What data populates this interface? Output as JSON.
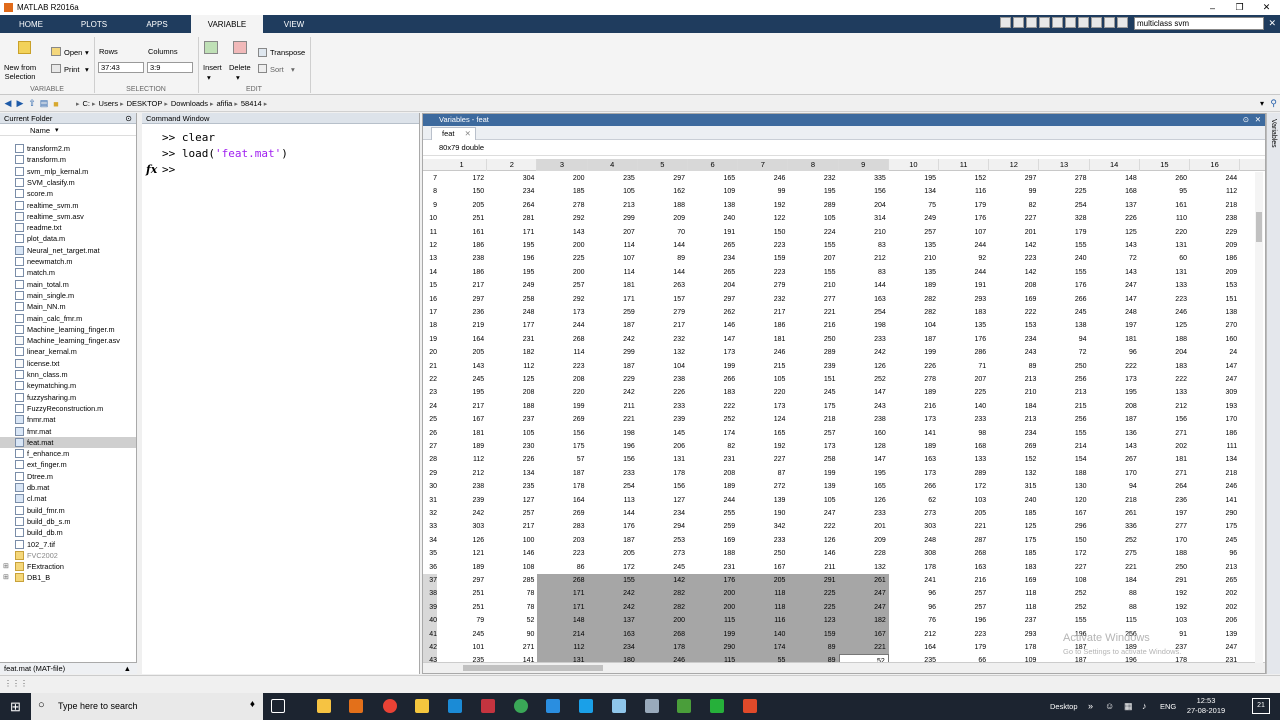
{
  "window": {
    "title": "MATLAB R2016a"
  },
  "tabs": [
    {
      "label": "HOME"
    },
    {
      "label": "PLOTS"
    },
    {
      "label": "APPS"
    },
    {
      "label": "VARIABLE"
    },
    {
      "label": "VIEW"
    }
  ],
  "search": {
    "value": "multiclass svm"
  },
  "ribbon": {
    "new_from_selection": "New from\nSelection",
    "open": "Open",
    "print": "Print",
    "rows_label": "Rows",
    "rows_value": "37:43",
    "columns_label": "Columns",
    "columns_value": "3:9",
    "insert": "Insert",
    "delete": "Delete",
    "transpose": "Transpose",
    "sort": "Sort",
    "group_variable": "VARIABLE",
    "group_selection": "SELECTION",
    "group_edit": "EDIT"
  },
  "path": [
    "C:",
    "Users",
    "DESKTOP",
    "Downloads",
    "afifia",
    "58414"
  ],
  "current_folder": {
    "title": "Current Folder",
    "name_col": "Name",
    "files": [
      "transform2.m",
      "transform.m",
      "svm_mlp_kernal.m",
      "SVM_clasify.m",
      "score.m",
      "realtime_svm.m",
      "realtime_svm.asv",
      "readme.txt",
      "plot_data.m",
      "Neural_net_target.mat",
      "neewmatch.m",
      "match.m",
      "main_total.m",
      "main_single.m",
      "Main_NN.m",
      "main_calc_fmr.m",
      "Machine_learning_finger.m",
      "Machine_learning_finger.asv",
      "linear_kernal.m",
      "license.txt",
      "knn_class.m",
      "keymatching.m",
      "fuzzysharing.m",
      "FuzzyReconstruction.m",
      "fnmr.mat",
      "fmr.mat",
      "feat.mat",
      "f_enhance.m",
      "ext_finger.m",
      "Dtree.m",
      "db.mat",
      "cl.mat",
      "build_fmr.m",
      "build_db_s.m",
      "build_db.m",
      "102_7.tif",
      "FVC2002",
      "FExtraction",
      "DB1_B"
    ],
    "selected": "feat.mat",
    "detail": "feat.mat  (MAT-file)"
  },
  "command_window": {
    "title": "Command Window",
    "lines": [
      ">> clear",
      ">> load(",
      ">> "
    ],
    "load_arg": "'feat.mat'",
    "load_close": ")"
  },
  "variables": {
    "title": "Variables - feat",
    "tab": "feat",
    "info": "80x79 double",
    "columns": [
      "1",
      "2",
      "3",
      "4",
      "5",
      "6",
      "7",
      "8",
      "9",
      "10",
      "11",
      "12",
      "13",
      "14",
      "15",
      "16"
    ],
    "rows": [
      {
        "n": 7,
        "v": [
          172,
          304,
          200,
          235,
          297,
          165,
          246,
          232,
          335,
          195,
          152,
          297,
          278,
          148,
          260,
          244
        ]
      },
      {
        "n": 8,
        "v": [
          150,
          234,
          185,
          105,
          162,
          109,
          99,
          195,
          156,
          134,
          116,
          99,
          225,
          168,
          95,
          112
        ]
      },
      {
        "n": 9,
        "v": [
          205,
          264,
          278,
          213,
          188,
          138,
          192,
          289,
          204,
          75,
          179,
          82,
          254,
          137,
          161,
          218
        ]
      },
      {
        "n": 10,
        "v": [
          251,
          281,
          292,
          299,
          209,
          240,
          122,
          105,
          314,
          249,
          176,
          227,
          328,
          226,
          110,
          238
        ]
      },
      {
        "n": 11,
        "v": [
          161,
          171,
          143,
          207,
          70,
          191,
          150,
          224,
          210,
          257,
          107,
          201,
          179,
          125,
          220,
          229
        ]
      },
      {
        "n": 12,
        "v": [
          186,
          195,
          200,
          114,
          144,
          265,
          223,
          155,
          83,
          135,
          244,
          142,
          155,
          143,
          131,
          209
        ]
      },
      {
        "n": 13,
        "v": [
          238,
          196,
          225,
          107,
          89,
          234,
          159,
          207,
          212,
          210,
          92,
          223,
          240,
          72,
          60,
          186
        ]
      },
      {
        "n": 14,
        "v": [
          186,
          195,
          200,
          114,
          144,
          265,
          223,
          155,
          83,
          135,
          244,
          142,
          155,
          143,
          131,
          209
        ]
      },
      {
        "n": 15,
        "v": [
          217,
          249,
          257,
          181,
          263,
          204,
          279,
          210,
          144,
          189,
          191,
          208,
          176,
          247,
          133,
          153
        ]
      },
      {
        "n": 16,
        "v": [
          297,
          258,
          292,
          171,
          157,
          297,
          232,
          277,
          163,
          282,
          293,
          169,
          266,
          147,
          223,
          151
        ]
      },
      {
        "n": 17,
        "v": [
          236,
          248,
          173,
          259,
          279,
          262,
          217,
          221,
          254,
          282,
          183,
          222,
          245,
          248,
          246,
          138
        ]
      },
      {
        "n": 18,
        "v": [
          219,
          177,
          244,
          187,
          217,
          146,
          186,
          216,
          198,
          104,
          135,
          153,
          138,
          197,
          125,
          270
        ]
      },
      {
        "n": 19,
        "v": [
          164,
          231,
          268,
          242,
          232,
          147,
          181,
          250,
          233,
          187,
          176,
          234,
          94,
          181,
          188,
          160
        ]
      },
      {
        "n": 20,
        "v": [
          205,
          182,
          114,
          299,
          132,
          173,
          246,
          289,
          242,
          199,
          286,
          243,
          72,
          96,
          204,
          24
        ]
      },
      {
        "n": 21,
        "v": [
          143,
          112,
          223,
          187,
          104,
          199,
          215,
          239,
          126,
          226,
          71,
          89,
          250,
          222,
          183,
          147
        ]
      },
      {
        "n": 22,
        "v": [
          245,
          125,
          208,
          229,
          238,
          266,
          105,
          151,
          252,
          278,
          207,
          213,
          256,
          173,
          222,
          247
        ]
      },
      {
        "n": 23,
        "v": [
          195,
          208,
          220,
          242,
          226,
          183,
          220,
          245,
          147,
          189,
          225,
          210,
          213,
          195,
          133,
          309
        ]
      },
      {
        "n": 24,
        "v": [
          217,
          188,
          199,
          211,
          233,
          222,
          173,
          175,
          243,
          216,
          140,
          184,
          215,
          208,
          212,
          193
        ]
      },
      {
        "n": 25,
        "v": [
          167,
          237,
          269,
          221,
          239,
          252,
          124,
          218,
          238,
          173,
          233,
          213,
          256,
          187,
          156,
          170
        ]
      },
      {
        "n": 26,
        "v": [
          181,
          105,
          156,
          198,
          145,
          174,
          165,
          257,
          160,
          141,
          98,
          234,
          155,
          136,
          271,
          186
        ]
      },
      {
        "n": 27,
        "v": [
          189,
          230,
          175,
          196,
          206,
          82,
          192,
          173,
          128,
          189,
          168,
          269,
          214,
          143,
          202,
          111
        ]
      },
      {
        "n": 28,
        "v": [
          112,
          226,
          57,
          156,
          131,
          231,
          227,
          258,
          147,
          163,
          133,
          152,
          154,
          267,
          181,
          134
        ]
      },
      {
        "n": 29,
        "v": [
          212,
          134,
          187,
          233,
          178,
          208,
          87,
          199,
          195,
          173,
          289,
          132,
          188,
          170,
          271,
          218
        ]
      },
      {
        "n": 30,
        "v": [
          238,
          235,
          178,
          254,
          156,
          189,
          272,
          139,
          165,
          266,
          172,
          315,
          130,
          94,
          264,
          246
        ]
      },
      {
        "n": 31,
        "v": [
          239,
          127,
          164,
          113,
          127,
          244,
          139,
          105,
          126,
          62,
          103,
          240,
          120,
          218,
          236,
          141
        ]
      },
      {
        "n": 32,
        "v": [
          242,
          257,
          269,
          144,
          234,
          255,
          190,
          247,
          233,
          273,
          205,
          185,
          167,
          261,
          197,
          290
        ]
      },
      {
        "n": 33,
        "v": [
          303,
          217,
          283,
          176,
          294,
          259,
          342,
          222,
          201,
          303,
          221,
          125,
          296,
          336,
          277,
          175
        ]
      },
      {
        "n": 34,
        "v": [
          126,
          100,
          203,
          187,
          253,
          169,
          233,
          126,
          209,
          248,
          287,
          175,
          150,
          252,
          170,
          245
        ]
      },
      {
        "n": 35,
        "v": [
          121,
          146,
          223,
          205,
          273,
          188,
          250,
          146,
          228,
          308,
          268,
          185,
          172,
          275,
          188,
          96
        ]
      },
      {
        "n": 36,
        "v": [
          189,
          108,
          86,
          172,
          245,
          231,
          167,
          211,
          132,
          178,
          163,
          183,
          227,
          221,
          250,
          213
        ]
      },
      {
        "n": 37,
        "v": [
          297,
          285,
          268,
          155,
          142,
          176,
          205,
          291,
          261,
          241,
          216,
          169,
          108,
          184,
          291,
          265
        ]
      },
      {
        "n": 38,
        "v": [
          251,
          78,
          171,
          242,
          282,
          200,
          118,
          225,
          247,
          96,
          257,
          118,
          252,
          88,
          192,
          202
        ]
      },
      {
        "n": 39,
        "v": [
          251,
          78,
          171,
          242,
          282,
          200,
          118,
          225,
          247,
          96,
          257,
          118,
          252,
          88,
          192,
          202
        ]
      },
      {
        "n": 40,
        "v": [
          79,
          52,
          148,
          137,
          200,
          115,
          116,
          123,
          182,
          76,
          196,
          237,
          155,
          115,
          103,
          206
        ]
      },
      {
        "n": 41,
        "v": [
          245,
          90,
          214,
          163,
          268,
          199,
          140,
          159,
          167,
          212,
          223,
          293,
          196,
          256,
          91,
          139
        ]
      },
      {
        "n": 42,
        "v": [
          101,
          271,
          112,
          234,
          178,
          290,
          174,
          89,
          221,
          164,
          179,
          178,
          187,
          189,
          237,
          247
        ]
      },
      {
        "n": 43,
        "v": [
          235,
          141,
          131,
          180,
          246,
          115,
          55,
          89,
          52,
          235,
          66,
          109,
          187,
          196,
          178,
          231
        ]
      }
    ]
  },
  "watermark": {
    "line1": "Activate Windows",
    "line2": "Go to Settings to activate Windows."
  },
  "taskbar": {
    "search": "Type here to search",
    "desktop": "Desktop",
    "lang": "ENG",
    "time": "12:53",
    "date": "27-08-2019",
    "notif": "21"
  }
}
